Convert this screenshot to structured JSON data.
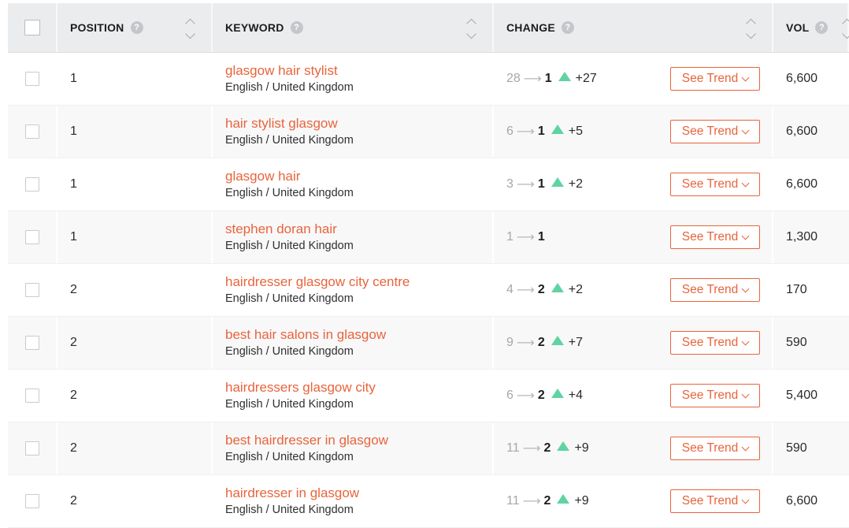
{
  "header": {
    "position": "POSITION",
    "keyword": "KEYWORD",
    "change": "CHANGE",
    "vol": "VOL",
    "help_glyph": "?"
  },
  "colors": {
    "accent": "#e8643c",
    "up_arrow": "#5fd3a3",
    "header_bg": "#ebecee"
  },
  "trend_label": "See Trend",
  "rows": [
    {
      "position": "1",
      "keyword": "glasgow hair stylist",
      "locale": "English / United Kingdom",
      "from": "28",
      "to": "1",
      "delta": "+27",
      "up": true,
      "volume": "6,600"
    },
    {
      "position": "1",
      "keyword": "hair stylist glasgow",
      "locale": "English / United Kingdom",
      "from": "6",
      "to": "1",
      "delta": "+5",
      "up": true,
      "volume": "6,600"
    },
    {
      "position": "1",
      "keyword": "glasgow hair",
      "locale": "English / United Kingdom",
      "from": "3",
      "to": "1",
      "delta": "+2",
      "up": true,
      "volume": "6,600"
    },
    {
      "position": "1",
      "keyword": "stephen doran hair",
      "locale": "English / United Kingdom",
      "from": "1",
      "to": "1",
      "delta": "",
      "up": false,
      "volume": "1,300"
    },
    {
      "position": "2",
      "keyword": "hairdresser glasgow city centre",
      "locale": "English / United Kingdom",
      "from": "4",
      "to": "2",
      "delta": "+2",
      "up": true,
      "volume": "170"
    },
    {
      "position": "2",
      "keyword": "best hair salons in glasgow",
      "locale": "English / United Kingdom",
      "from": "9",
      "to": "2",
      "delta": "+7",
      "up": true,
      "volume": "590"
    },
    {
      "position": "2",
      "keyword": "hairdressers glasgow city",
      "locale": "English / United Kingdom",
      "from": "6",
      "to": "2",
      "delta": "+4",
      "up": true,
      "volume": "5,400"
    },
    {
      "position": "2",
      "keyword": "best hairdresser in glasgow",
      "locale": "English / United Kingdom",
      "from": "11",
      "to": "2",
      "delta": "+9",
      "up": true,
      "volume": "590"
    },
    {
      "position": "2",
      "keyword": "hairdresser in glasgow",
      "locale": "English / United Kingdom",
      "from": "11",
      "to": "2",
      "delta": "+9",
      "up": true,
      "volume": "6,600"
    }
  ]
}
